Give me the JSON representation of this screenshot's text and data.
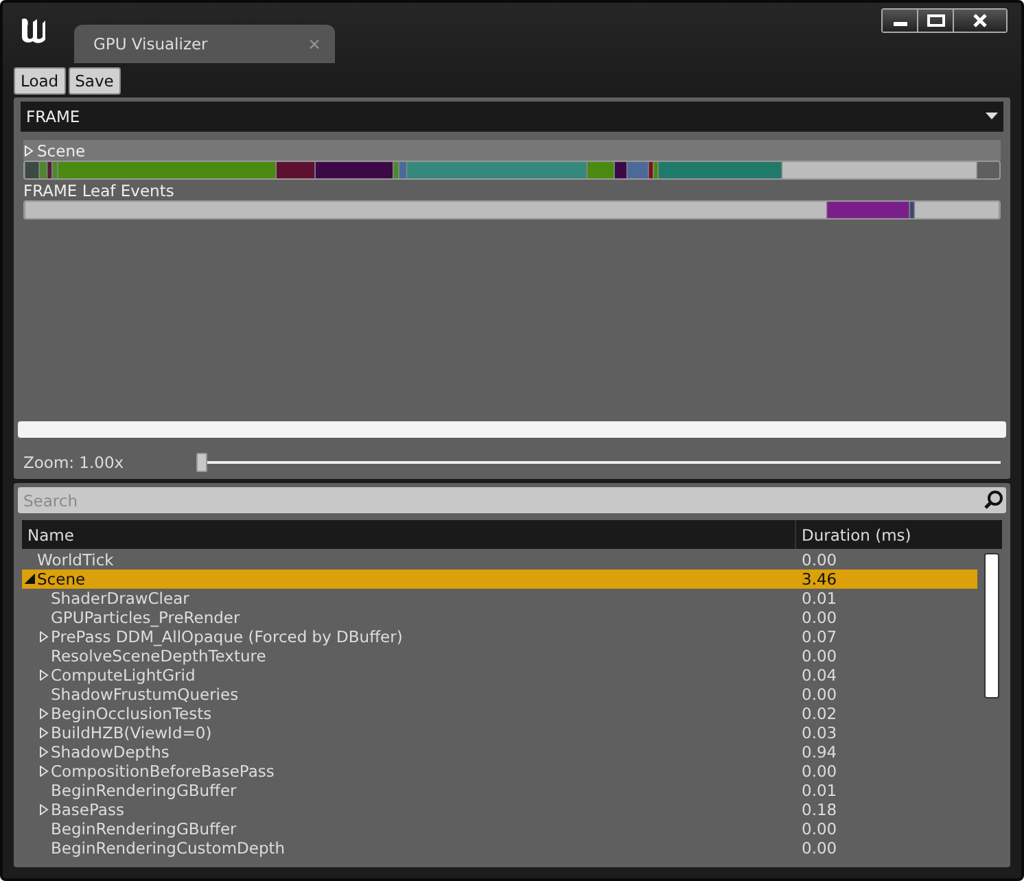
{
  "window": {
    "tab_title": "GPU Visualizer",
    "tab_close": "×"
  },
  "toolbar": {
    "buttons": [
      "Load",
      "Save"
    ]
  },
  "frame_dropdown": {
    "value": "FRAME"
  },
  "timeline": {
    "tracks": [
      {
        "label": "Scene",
        "has_children": true,
        "expanded": false
      },
      {
        "label": "FRAME Leaf Events",
        "has_children": false
      }
    ]
  },
  "zoom": {
    "label": "Zoom: 1.00x",
    "level": 0.0
  },
  "search": {
    "placeholder": "Search"
  },
  "table": {
    "columns": [
      "Name",
      "Duration (ms)"
    ],
    "rows": [
      {
        "name": "WorldTick",
        "duration": "0.00",
        "has_children": false,
        "selected": false,
        "children": []
      },
      {
        "name": "Scene",
        "duration": "3.46",
        "has_children": true,
        "expanded": true,
        "selected": true,
        "children": [
          {
            "name": "ShaderDrawClear",
            "duration": "0.01",
            "has_children": false,
            "selected": false
          },
          {
            "name": "GPUParticles_PreRender",
            "duration": "0.00",
            "has_children": false,
            "selected": false
          },
          {
            "name": "PrePass DDM_AllOpaque (Forced by DBuffer)",
            "duration": "0.07",
            "has_children": true,
            "expanded": false,
            "selected": false
          },
          {
            "name": "ResolveSceneDepthTexture",
            "duration": "0.00",
            "has_children": false,
            "selected": false
          },
          {
            "name": "ComputeLightGrid",
            "duration": "0.04",
            "has_children": true,
            "expanded": false,
            "selected": false
          },
          {
            "name": "ShadowFrustumQueries",
            "duration": "0.00",
            "has_children": false,
            "selected": false
          },
          {
            "name": "BeginOcclusionTests",
            "duration": "0.02",
            "has_children": true,
            "expanded": false,
            "selected": false
          },
          {
            "name": "BuildHZB(ViewId=0)",
            "duration": "0.03",
            "has_children": true,
            "expanded": false,
            "selected": false
          },
          {
            "name": "ShadowDepths",
            "duration": "0.94",
            "has_children": true,
            "expanded": false,
            "selected": false
          },
          {
            "name": "CompositionBeforeBasePass",
            "duration": "0.00",
            "has_children": true,
            "expanded": false,
            "selected": false
          },
          {
            "name": "BeginRenderingGBuffer",
            "duration": "0.01",
            "has_children": false,
            "selected": false
          },
          {
            "name": "BasePass",
            "duration": "0.18",
            "has_children": true,
            "expanded": false,
            "selected": false
          },
          {
            "name": "BeginRenderingGBuffer",
            "duration": "0.00",
            "has_children": false,
            "selected": false
          },
          {
            "name": "BeginRenderingCustomDepth",
            "duration": "0.00",
            "has_children": false,
            "selected": false
          }
        ]
      }
    ]
  }
}
